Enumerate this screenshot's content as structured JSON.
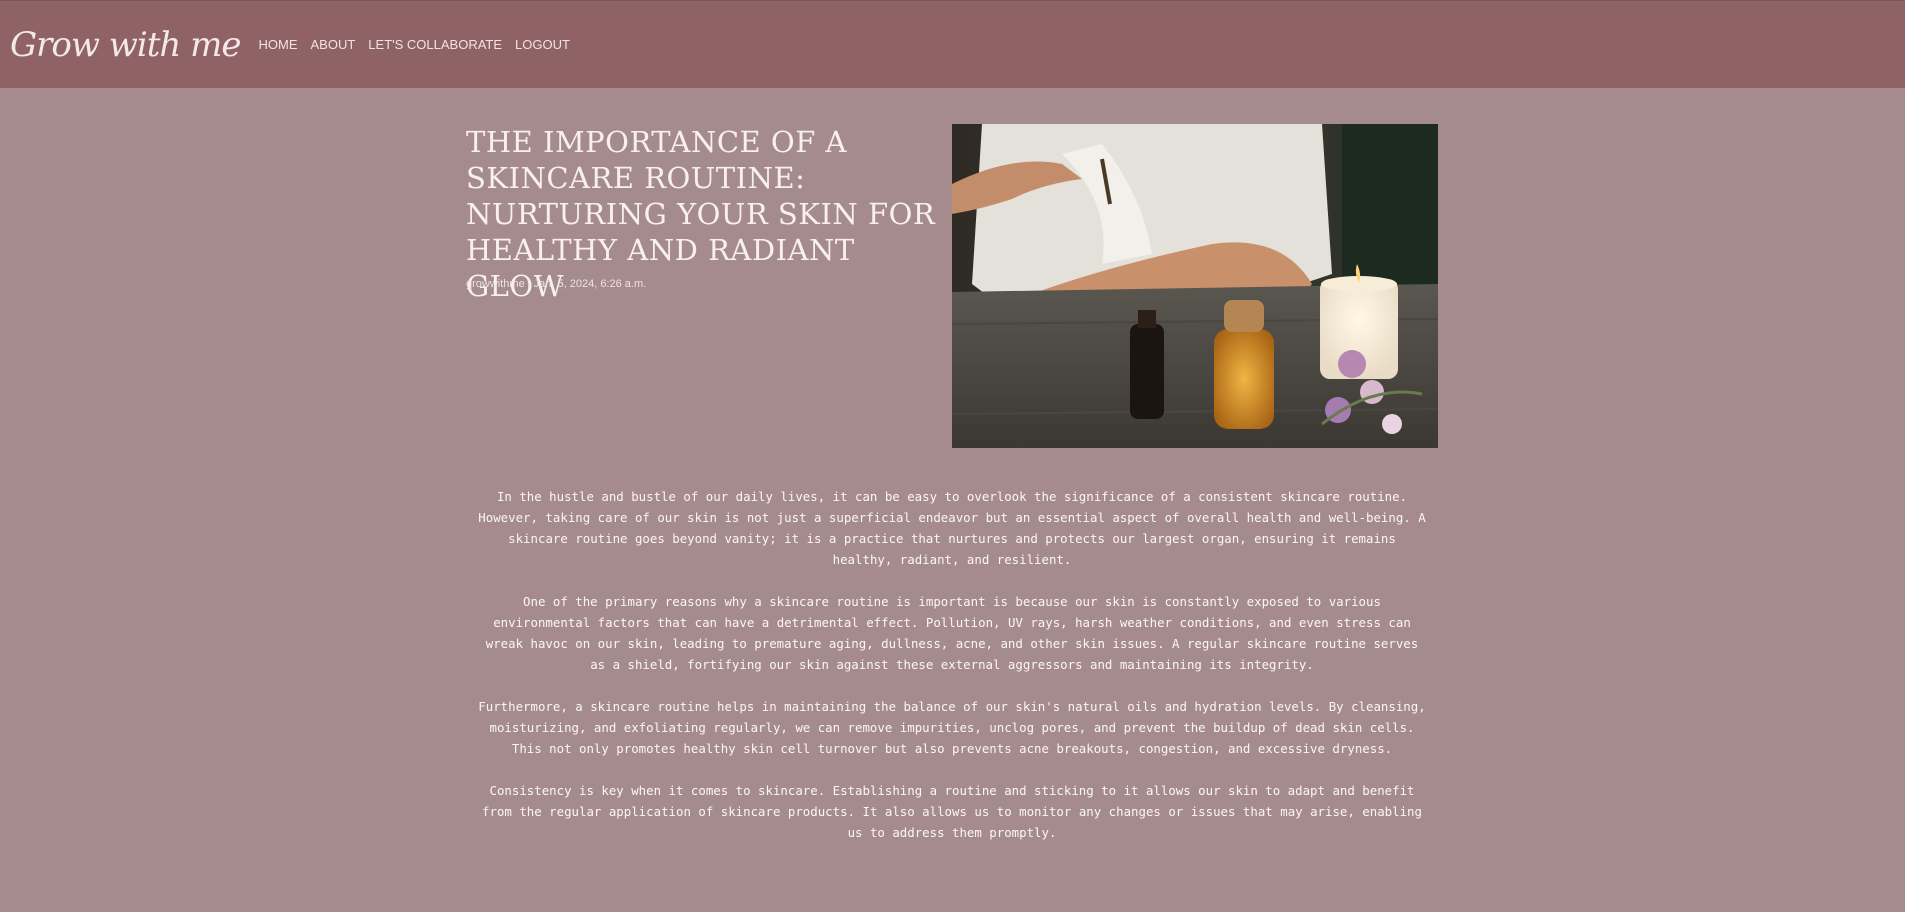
{
  "nav": {
    "brand": "Grow with me",
    "links": [
      "HOME",
      "ABOUT",
      "LET'S COLLABORATE",
      "LOGOUT"
    ]
  },
  "post": {
    "title": "THE IMPORTANCE OF A SKINCARE ROUTINE: NURTURING YOUR SKIN FOR HEALTHY AND RADIANT GLOW",
    "meta": "growwithme | Jan. 5, 2024, 6:26 a.m.",
    "paragraphs": [
      "In the hustle and bustle of our daily lives, it can be easy to overlook the significance of a consistent skincare routine. However, taking care of our skin is not just a superficial endeavor but an essential aspect of overall health and well-being. A skincare routine goes beyond vanity; it is a practice that nurtures and protects our largest organ, ensuring it remains healthy, radiant, and resilient.",
      "One of the primary reasons why a skincare routine is important is because our skin is constantly exposed to various environmental factors that can have a detrimental effect. Pollution, UV rays, harsh weather conditions, and even stress can wreak havoc on our skin, leading to premature aging, dullness, acne, and other skin issues. A regular skincare routine serves as a shield, fortifying our skin against these external aggressors and maintaining its integrity.",
      "Furthermore, a skincare routine helps in maintaining the balance of our skin's natural oils and hydration levels. By cleansing, moisturizing, and exfoliating regularly, we can remove impurities, unclog pores, and prevent the buildup of dead skin cells. This not only promotes healthy skin cell turnover but also prevents acne breakouts, congestion, and excessive dryness.",
      "Consistency is key when it comes to skincare. Establishing a routine and sticking to it allows our skin to adapt and benefit from the regular application of skincare products. It also allows us to monitor any changes or issues that may arise, enabling us to address them promptly."
    ]
  },
  "colors": {
    "navbar": "#8f6366",
    "background": "#a68b8d",
    "text": "#fbf6f6"
  }
}
